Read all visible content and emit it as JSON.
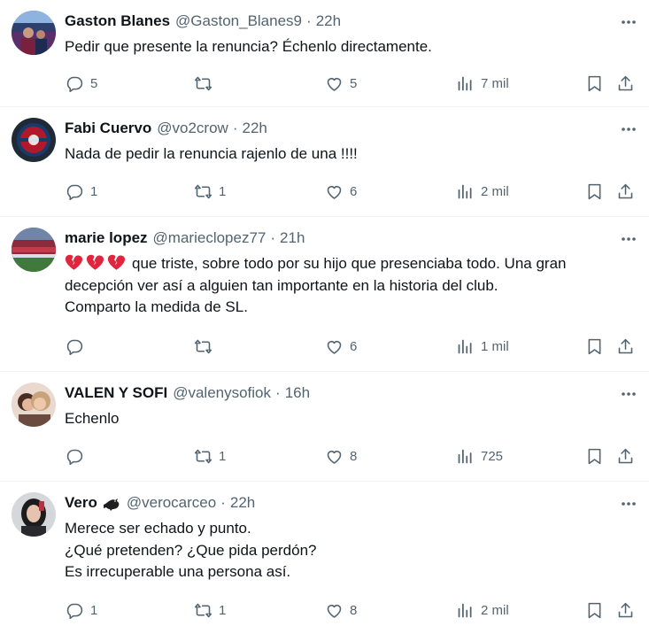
{
  "tweets": [
    {
      "name": "Gaston Blanes",
      "handle": "@Gaston_Blanes9",
      "separator": "·",
      "time": "22h",
      "lines": [
        "Pedir que presente la renuncia? Échenlo directamente."
      ],
      "replies": "5",
      "retweets": "",
      "likes": "5",
      "views": "7 mil"
    },
    {
      "name": "Fabi Cuervo",
      "handle": "@vo2crow",
      "separator": "·",
      "time": "22h",
      "lines": [
        "Nada de pedir la renuncia rajenlo de una !!!!"
      ],
      "replies": "1",
      "retweets": "1",
      "likes": "6",
      "views": "2 mil"
    },
    {
      "name": "marie lopez",
      "handle": "@marieclopez77",
      "separator": "·",
      "time": "21h",
      "emoji": [
        "broken-heart",
        "broken-heart",
        "broken-heart"
      ],
      "lines": [
        "que triste, sobre todo por su hijo que presenciaba todo. Una gran",
        "decepción ver así a alguien tan importante en la historia del club.",
        "Comparto la medida de SL."
      ],
      "replies": "",
      "retweets": "",
      "likes": "6",
      "views": "1 mil"
    },
    {
      "name": "VALEN Y SOFI",
      "handle": "@valenysofiok",
      "separator": "·",
      "time": "16h",
      "lines": [
        "Echenlo"
      ],
      "replies": "",
      "retweets": "1",
      "likes": "8",
      "views": "725"
    },
    {
      "name": "Vero",
      "name_emoji": "bird-icon",
      "handle": "@verocarceo",
      "separator": "·",
      "time": "22h",
      "lines": [
        "Merece ser echado y punto.",
        "¿Qué pretenden? ¿Que pida perdón?",
        "Es irrecuperable una persona así."
      ],
      "replies": "1",
      "retweets": "1",
      "likes": "8",
      "views": "2 mil"
    }
  ],
  "colors": {
    "text": "#0f1419",
    "secondary": "#536471",
    "divider": "#eff3f4",
    "broken_heart": "#e0263c"
  },
  "icons": [
    "reply-icon",
    "retweet-icon",
    "like-icon",
    "views-icon",
    "bookmark-icon",
    "share-icon",
    "more-icon"
  ]
}
